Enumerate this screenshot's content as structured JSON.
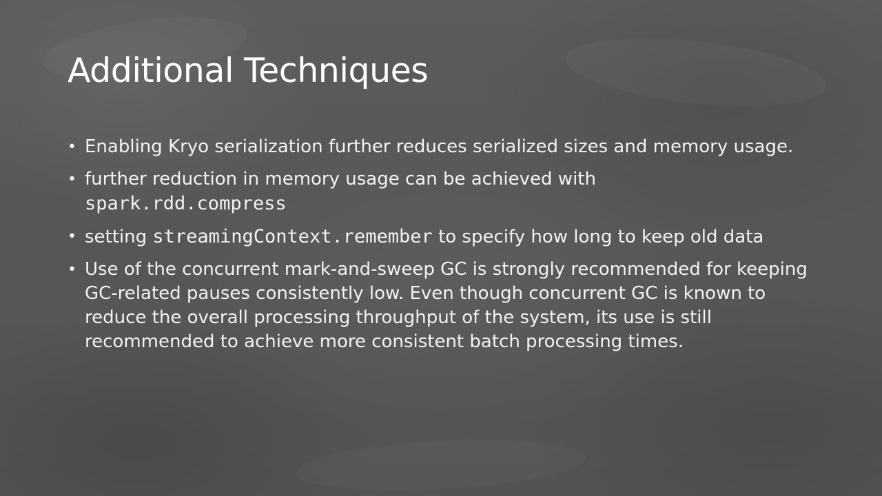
{
  "slide": {
    "title": "Additional Techniques",
    "bullet_glyph": "•",
    "bullets": [
      {
        "text": "Enabling Kryo serialization further reduces serialized sizes and memory usage."
      },
      {
        "before": "further reduction in memory usage can be achieved with",
        "code": "spark.rdd.compress"
      },
      {
        "before": "setting",
        "code": "streamingContext.remember",
        "after": "to specify how long to keep old data"
      },
      {
        "text": "Use of the concurrent mark-and-sweep GC is strongly recommended for keeping GC-related pauses consistently low. Even though concurrent GC is known to reduce the overall processing throughput of the system, its use is still recommended to achieve more consistent batch processing times."
      }
    ],
    "colors": {
      "background": "#585858",
      "text": "#ffffff"
    }
  }
}
